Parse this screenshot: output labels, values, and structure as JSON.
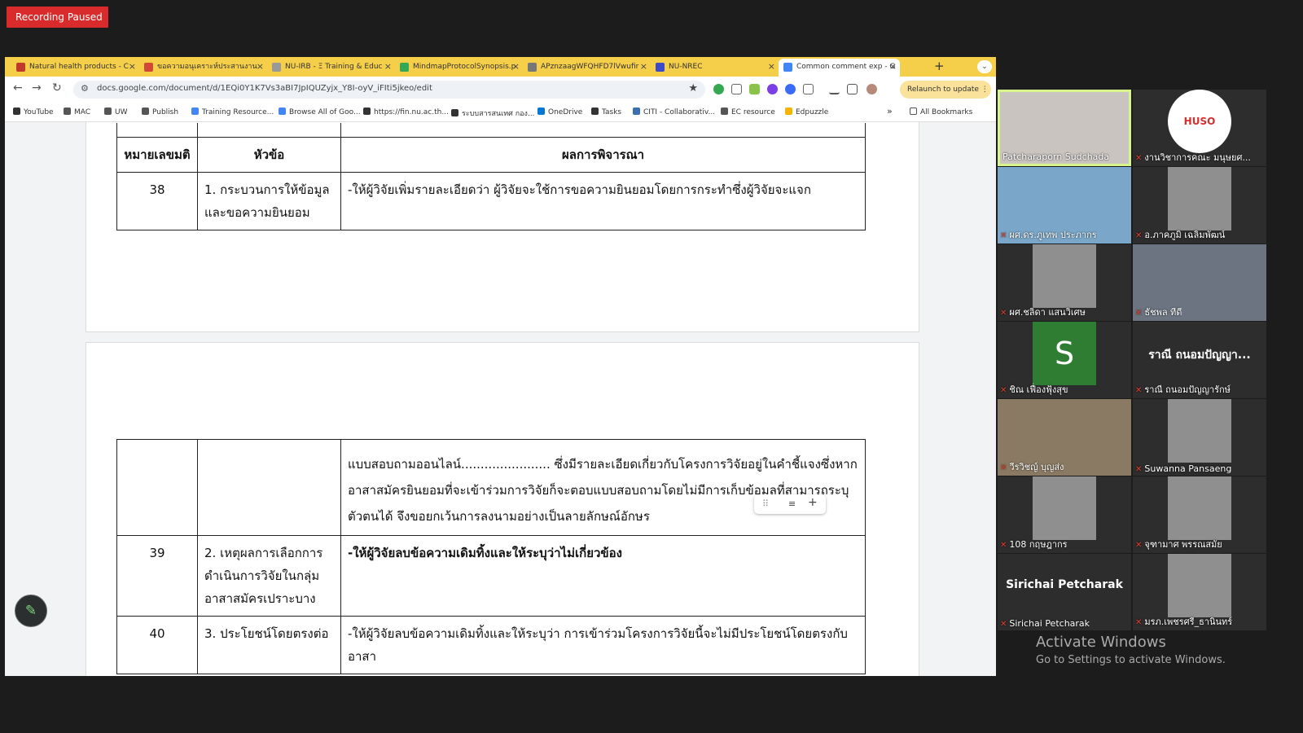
{
  "recording": {
    "label": "Recording Paused"
  },
  "tabs": [
    {
      "title": "Natural health products - C",
      "color": "#c0392b"
    },
    {
      "title": "ขอความอนุเคราะห์ประสานงาน",
      "color": "#d14836"
    },
    {
      "title": "NU-IRB - Ξ Training & Educ",
      "color": "#999999"
    },
    {
      "title": "MindmapProtocolSynopsis.p",
      "color": "#34a853"
    },
    {
      "title": "APznzaagWFQHFD7lVwufir",
      "color": "#777777"
    },
    {
      "title": "NU-NREC",
      "color": "#3c4cc8"
    },
    {
      "title": "Common comment exp - G",
      "color": "#4285f4"
    }
  ],
  "toolbar": {
    "url": "docs.google.com/document/d/1EQi0Y1K7Vs3aBI7JpIQUZyjx_Y8I-oyV_iFIti5jkeo/edit",
    "relaunch_label": "Relaunch to update"
  },
  "bookmarks": [
    {
      "label": "YouTube",
      "color": "#333333"
    },
    {
      "label": "MAC",
      "color": "#555555"
    },
    {
      "label": "UW",
      "color": "#555555"
    },
    {
      "label": "Publish",
      "color": "#555555"
    },
    {
      "label": "Training Resource...",
      "color": "#4285f4"
    },
    {
      "label": "Browse All of Goo...",
      "color": "#4285f4"
    },
    {
      "label": "https://fin.nu.ac.th...",
      "color": "#333333"
    },
    {
      "label": "ระบบสารสนเทศ กอง...",
      "color": "#333333"
    },
    {
      "label": "OneDrive",
      "color": "#0078d4"
    },
    {
      "label": "Tasks",
      "color": "#333333"
    },
    {
      "label": "CITI - Collaborativ...",
      "color": "#3c6eb4"
    },
    {
      "label": "EC resource",
      "color": "#555555"
    },
    {
      "label": "Edpuzzle",
      "color": "#f4b400"
    }
  ],
  "all_bookmarks": "All Bookmarks",
  "doc": {
    "headers": {
      "num": "หมายเลขมติ",
      "topic": "หัวข้อ",
      "result": "ผลการพิจารณา"
    },
    "rows_page1": [
      {
        "num": "38",
        "topic": "1. กระบวนการให้ข้อมูลและขอความยินยอม",
        "result": "-ให้ผู้วิจัยเพิ่มรายละเอียดว่า ผู้วิจัยจะใช้การขอความยินยอมโดยการกระทำซึ่งผู้วิจัยจะแจก"
      }
    ],
    "rows_page2": [
      {
        "num": "",
        "topic": "",
        "result": "แบบสอบถามออนไลน์....................... ซึ่งมีรายละเอียดเกี่ยวกับโครงการวิจัยอยู่ในคำชี้แจงซึ่งหากอาสาสมัครยินยอมที่จะเข้าร่วมการวิจัยก็จะตอบแบบสอบถามโดยไม่มีการเก็บข้อมูลที่สามารถระบุตัวตนได้ จึงขอยกเว้นการลงนามอย่างเป็นลายลักษณ์อักษร"
      },
      {
        "num": "39",
        "topic": "2. เหตุผลการเลือกการดำเนินการวิจัยในกลุ่มอาสาสมัครเปราะบาง",
        "result": "-ให้ผู้วิจัยลบข้อความเดิมทิ้งและให้ระบุว่าไม่เกี่ยวข้อง"
      },
      {
        "num": "40",
        "topic": "3. ประโยชน์โดยตรงต่อ",
        "result": "-ให้ผู้วิจัยลบข้อความเดิมทิ้งและให้ระบุว่า การเข้าร่วมโครงการวิจัยนี้จะไม่มีประโยชน์โดยตรงกับอาสา"
      }
    ]
  },
  "participants": [
    {
      "name": "Patcharaporn Sudchada",
      "muted": false,
      "speaking": true,
      "bg": "#c9c4c0"
    },
    {
      "name": "งานวิชาการคณะ มนุษยศ...",
      "muted": true,
      "speaking": false,
      "bg": "#2d2d2d",
      "logo": "HUSO"
    },
    {
      "name": "ผศ.ดร.ภูเทพ ประภากร",
      "muted": true,
      "speaking": false,
      "bg": "#7aa7c9"
    },
    {
      "name": "อ.ภาคภูมิ เฉลิมพัฒน์",
      "muted": true,
      "speaking": false,
      "bg": "#2d2d2d"
    },
    {
      "name": "ผศ.ชลิดา แสนวิเศษ",
      "muted": true,
      "speaking": false,
      "bg": "#2d2d2d"
    },
    {
      "name": "ธัชพล ทีดี",
      "muted": true,
      "speaking": false,
      "bg": "#6b7480"
    },
    {
      "name": "ชิณ เฟื่องฟุ้งสุข",
      "muted": true,
      "speaking": false,
      "bg": "#2d2d2d",
      "initial": "S"
    },
    {
      "name": "ราณี ถนอมปัญญารักษ์",
      "muted": true,
      "speaking": false,
      "bg": "#2d2d2d",
      "big": "ราณี ถนอมปัญญา..."
    },
    {
      "name": "วีรวิชญ์ บุญส่ง",
      "muted": true,
      "speaking": false,
      "bg": "#8a7a63"
    },
    {
      "name": "Suwanna Pansaeng",
      "muted": true,
      "speaking": false,
      "bg": "#2d2d2d"
    },
    {
      "name": "108 กฤษฎากร",
      "muted": true,
      "speaking": false,
      "bg": "#2d2d2d"
    },
    {
      "name": "จุฑามาศ พรรณสมัย",
      "muted": true,
      "speaking": false,
      "bg": "#2d2d2d"
    },
    {
      "name": "Sirichai Petcharak",
      "muted": true,
      "speaking": false,
      "bg": "#2d2d2d",
      "big": "Sirichai Petcharak"
    },
    {
      "name": "มรภ.เพชรศรี_ธานินทร์",
      "muted": true,
      "speaking": false,
      "bg": "#2d2d2d"
    }
  ],
  "windows_notice": {
    "title": "Activate Windows",
    "sub": "Go to Settings to activate Windows."
  }
}
